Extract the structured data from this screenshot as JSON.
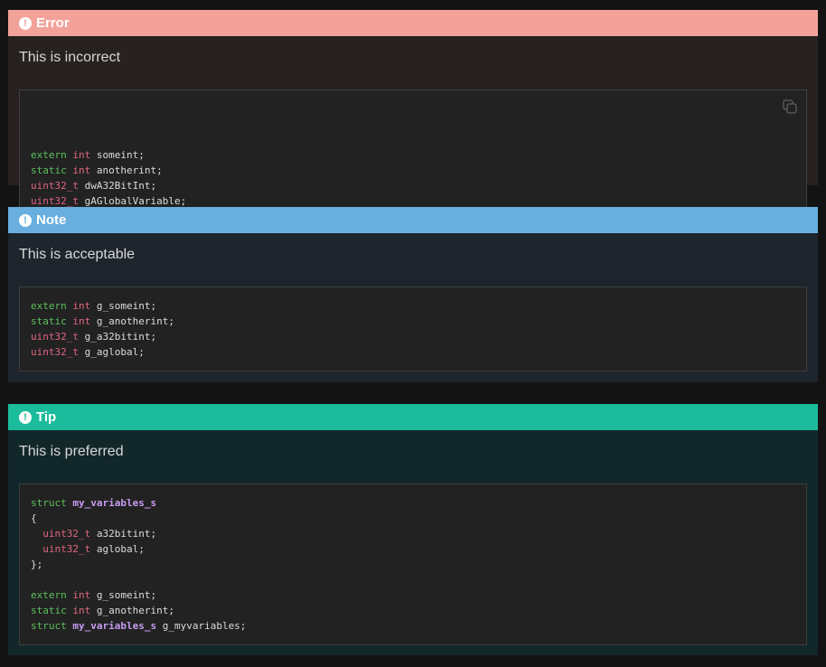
{
  "error": {
    "title": "Error",
    "text": "This is incorrect",
    "code": [
      [
        {
          "c": "k",
          "t": "extern"
        },
        {
          "c": "",
          "t": " "
        },
        {
          "c": "t",
          "t": "int"
        },
        {
          "c": "",
          "t": " someint;"
        }
      ],
      [
        {
          "c": "k",
          "t": "static"
        },
        {
          "c": "",
          "t": " "
        },
        {
          "c": "t",
          "t": "int"
        },
        {
          "c": "",
          "t": " anotherint;"
        }
      ],
      [
        {
          "c": "t",
          "t": "uint32_t"
        },
        {
          "c": "",
          "t": " dwA32BitInt;"
        }
      ],
      [
        {
          "c": "t",
          "t": "uint32_t"
        },
        {
          "c": "",
          "t": " gAGlobalVariable;"
        }
      ]
    ]
  },
  "note": {
    "title": "Note",
    "text": "This is acceptable",
    "code": [
      [
        {
          "c": "k",
          "t": "extern"
        },
        {
          "c": "",
          "t": " "
        },
        {
          "c": "t",
          "t": "int"
        },
        {
          "c": "",
          "t": " g_someint;"
        }
      ],
      [
        {
          "c": "k",
          "t": "static"
        },
        {
          "c": "",
          "t": " "
        },
        {
          "c": "t",
          "t": "int"
        },
        {
          "c": "",
          "t": " g_anotherint;"
        }
      ],
      [
        {
          "c": "t",
          "t": "uint32_t"
        },
        {
          "c": "",
          "t": " g_a32bitint;"
        }
      ],
      [
        {
          "c": "t",
          "t": "uint32_t"
        },
        {
          "c": "",
          "t": " g_aglobal;"
        }
      ]
    ]
  },
  "tip": {
    "title": "Tip",
    "text": "This is preferred",
    "code": [
      [
        {
          "c": "k",
          "t": "struct"
        },
        {
          "c": "",
          "t": " "
        },
        {
          "c": "s",
          "t": "my_variables_s"
        }
      ],
      [
        {
          "c": "",
          "t": "{"
        }
      ],
      [
        {
          "c": "",
          "t": "  "
        },
        {
          "c": "t",
          "t": "uint32_t"
        },
        {
          "c": "",
          "t": " a32bitint;"
        }
      ],
      [
        {
          "c": "",
          "t": "  "
        },
        {
          "c": "t",
          "t": "uint32_t"
        },
        {
          "c": "",
          "t": " aglobal;"
        }
      ],
      [
        {
          "c": "",
          "t": "};"
        }
      ],
      [],
      [
        {
          "c": "k",
          "t": "extern"
        },
        {
          "c": "",
          "t": " "
        },
        {
          "c": "t",
          "t": "int"
        },
        {
          "c": "",
          "t": " g_someint;"
        }
      ],
      [
        {
          "c": "k",
          "t": "static"
        },
        {
          "c": "",
          "t": " "
        },
        {
          "c": "t",
          "t": "int"
        },
        {
          "c": "",
          "t": " g_anotherint;"
        }
      ],
      [
        {
          "c": "k",
          "t": "struct"
        },
        {
          "c": "",
          "t": " "
        },
        {
          "c": "s",
          "t": "my_variables_s"
        },
        {
          "c": "",
          "t": " g_myvariables;"
        }
      ]
    ]
  },
  "icons": {
    "admonition": "exclamation-circle-icon",
    "copy": "copy-icon"
  },
  "colors": {
    "error_header": "#f2a299",
    "note_header": "#68afdf",
    "tip_header": "#1bbc9b",
    "keyword": "#5cc05c",
    "type": "#e06680",
    "struct_name": "#c79cf0"
  }
}
